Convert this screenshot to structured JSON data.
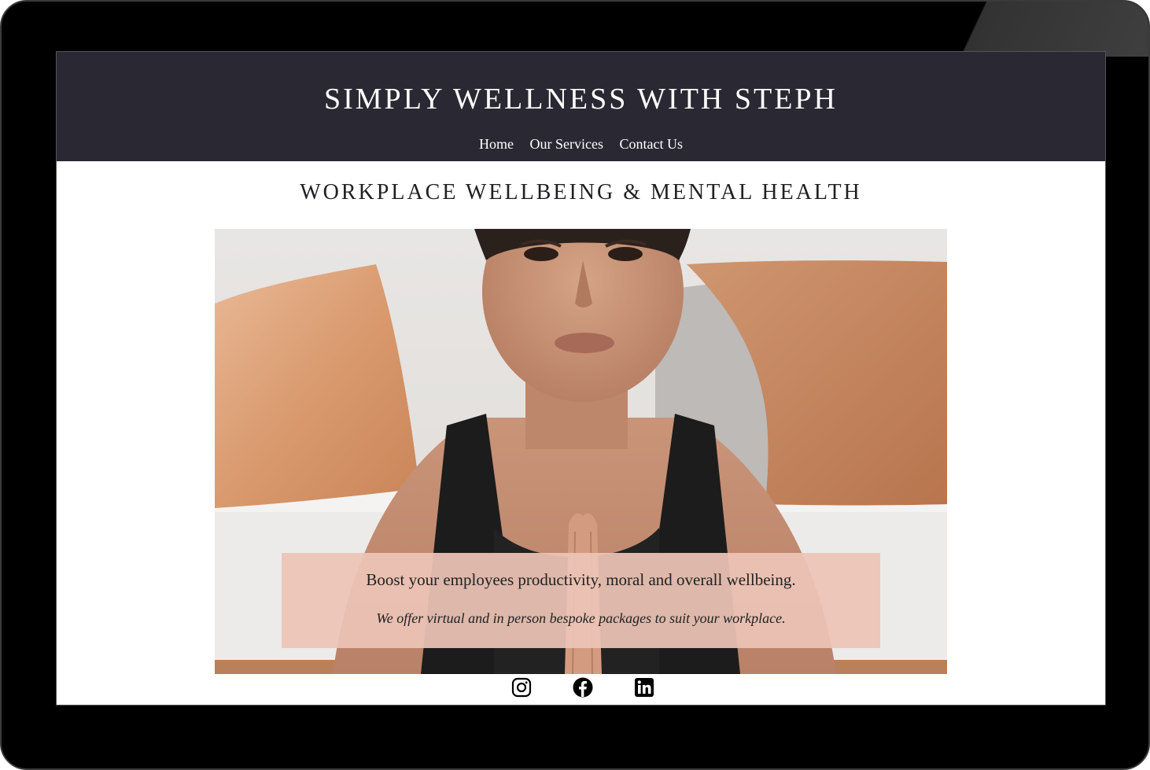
{
  "site": {
    "title": "SIMPLY WELLNESS WITH STEPH"
  },
  "nav": {
    "items": [
      {
        "label": "Home"
      },
      {
        "label": "Our Services"
      },
      {
        "label": "Contact Us"
      }
    ]
  },
  "main": {
    "headline": "WORKPLACE WELLBEING & MENTAL HEALTH",
    "hero": {
      "tagline": "Boost your employees productivity, moral and overall wellbeing.",
      "subtagline": "We offer virtual and in person bespoke packages to suit your workplace."
    }
  },
  "social": {
    "icons": [
      "instagram-icon",
      "facebook-icon",
      "linkedin-icon"
    ]
  },
  "colors": {
    "header_bg": "#292833",
    "overlay_bg": "#ecc4b6",
    "device_frame": "#000000"
  }
}
